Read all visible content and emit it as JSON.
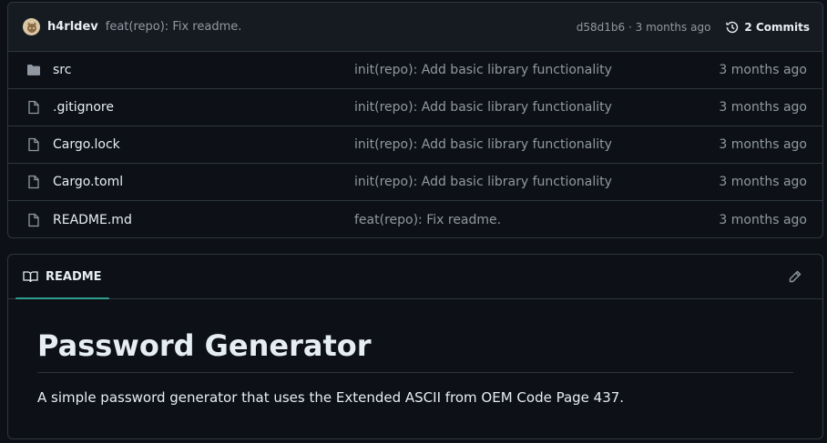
{
  "latest_commit": {
    "author": "h4rldev",
    "message": "feat(repo): Fix readme.",
    "hash": "d58d1b6",
    "separator": "·",
    "age": "3 months ago",
    "commits_label": "2 Commits"
  },
  "files": [
    {
      "name": "src",
      "type": "folder",
      "commit": "init(repo): Add basic library functionality",
      "age": "3 months ago"
    },
    {
      "name": ".gitignore",
      "type": "file",
      "commit": "init(repo): Add basic library functionality",
      "age": "3 months ago"
    },
    {
      "name": "Cargo.lock",
      "type": "file",
      "commit": "init(repo): Add basic library functionality",
      "age": "3 months ago"
    },
    {
      "name": "Cargo.toml",
      "type": "file",
      "commit": "init(repo): Add basic library functionality",
      "age": "3 months ago"
    },
    {
      "name": "README.md",
      "type": "file",
      "commit": "feat(repo): Fix readme.",
      "age": "3 months ago"
    }
  ],
  "readme": {
    "tab_label": "README",
    "title": "Password Generator",
    "description": "A simple password generator that uses the Extended ASCII from OEM Code Page 437."
  },
  "colors": {
    "background": "#0d1117",
    "border": "#30363d",
    "muted": "#9198a1",
    "text": "#e6edf3",
    "tab_underline": "#2f9e8f"
  }
}
